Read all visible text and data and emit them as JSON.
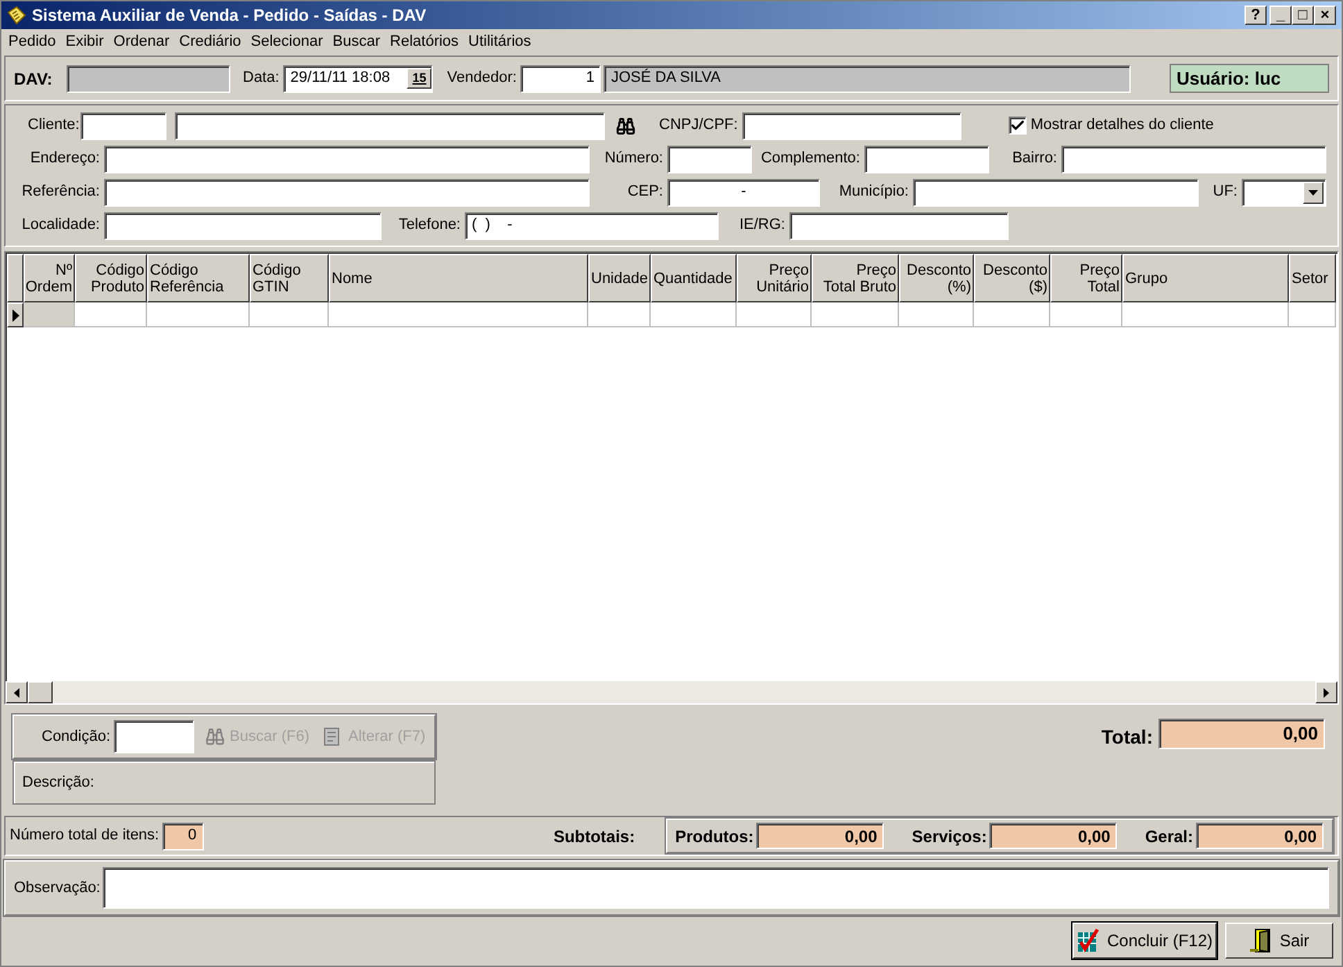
{
  "window": {
    "title": "Sistema Auxiliar de Venda - Pedido - Saídas - DAV",
    "controls": [
      "?",
      "_",
      "□",
      "×"
    ]
  },
  "menu": [
    "Pedido",
    "Exibir",
    "Ordenar",
    "Crediário",
    "Selecionar",
    "Buscar",
    "Relatórios",
    "Utilitários"
  ],
  "header": {
    "dav_label": "DAV:",
    "date_label": "Data:",
    "date_value": "29/11/11 18:08",
    "calendar_button": "15",
    "vendor_label": "Vendedor:",
    "vendor_code": "1",
    "vendor_name": "JOSÉ DA SILVA",
    "user": "Usuário: luc"
  },
  "client": {
    "cliente_label": "Cliente:",
    "cnpj_label": "CNPJ/CPF:",
    "show_details": {
      "label": "Mostrar detalhes do cliente",
      "checked": true
    },
    "endereco_label": "Endereço:",
    "numero_label": "Número:",
    "complemento_label": "Complemento:",
    "bairro_label": "Bairro:",
    "referencia_label": "Referência:",
    "cep_label": "CEP:",
    "cep_value": "-",
    "municipio_label": "Município:",
    "uf_label": "UF:",
    "localidade_label": "Localidade:",
    "telefone_label": "Telefone:",
    "telefone_value": "(  )    -",
    "ie_label": "IE/RG:"
  },
  "table": {
    "columns": [
      "Nº\nOrdem",
      "Código\nProduto",
      "Código\nReferência",
      "Código\nGTIN",
      "Nome",
      "Unidade",
      "Quantidade",
      "Preço\nUnitário",
      "Preço\nTotal Bruto",
      "Desconto\n(%)",
      "Desconto\n($)",
      "Preço\nTotal",
      "Grupo",
      "Setor"
    ]
  },
  "payment": {
    "condicao_label": "Condição:",
    "buttons": [
      {
        "kind": "search",
        "label": "Buscar (F6)",
        "disabled": true
      },
      {
        "kind": "edit",
        "label": "Alterar (F7)",
        "disabled": true
      }
    ],
    "descricao_label": "Descrição:",
    "total_label": "Total:",
    "total_value": "0,00"
  },
  "subtotals": {
    "items_label": "Número total de itens:",
    "items_value": "0",
    "label": "Subtotais:",
    "values": [
      {
        "label": "Produtos:",
        "value": "0,00"
      },
      {
        "label": "Serviços:",
        "value": "0,00"
      },
      {
        "label": "Geral:",
        "value": "0,00"
      }
    ]
  },
  "observacao_label": "Observação:",
  "buttons": [
    {
      "kind": "confirm",
      "label": "Concluir (F12)",
      "default": true
    },
    {
      "kind": "exit",
      "label": "Sair",
      "default": false
    }
  ]
}
